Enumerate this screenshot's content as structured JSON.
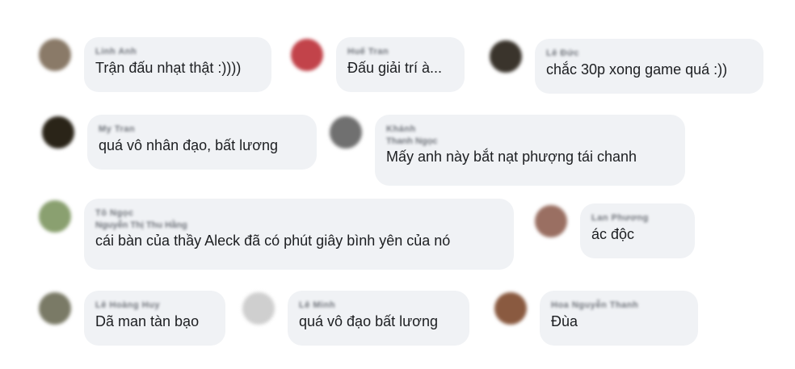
{
  "comments": [
    {
      "name": "Linh Anh",
      "meta": "",
      "text": "Trận đấu nhạt thật :))))",
      "avatar_color": "#8a7a68"
    },
    {
      "name": "Huế Tran",
      "meta": "",
      "text": "Đấu giải trí à...",
      "avatar_color": "#c2434a"
    },
    {
      "name": "Lê Đức",
      "meta": "",
      "text": "chắc 30p xong game quá :))",
      "avatar_color": "#3a342c"
    },
    {
      "name": "My Tran",
      "meta": "",
      "text": "quá vô nhân đạo, bất lương",
      "avatar_color": "#2a2418"
    },
    {
      "name": "Khánh",
      "meta": "Thanh Ngọc",
      "text": "Mấy anh này bắt nạt phượng tái chanh",
      "avatar_color": "#707070"
    },
    {
      "name": "Tô Ngọc",
      "meta": "Nguyễn Thị Thu Hằng",
      "text": "cái bàn của thầy Aleck đã có phút giây bình yên của nó",
      "avatar_color": "#8aa070"
    },
    {
      "name": "Lan Phương",
      "meta": "",
      "text": "ác độc",
      "avatar_color": "#9a6f62"
    },
    {
      "name": "Lê Hoàng Huy",
      "meta": "",
      "text": "Dã man tàn bạo",
      "avatar_color": "#7a7a66"
    },
    {
      "name": "Lê Minh",
      "meta": "",
      "text": "quá vô đạo bất lương",
      "avatar_color": "#cfcfcf"
    },
    {
      "name": "Hoa Nguyễn Thanh",
      "meta": "",
      "text": "Đùa",
      "avatar_color": "#8a5a40"
    }
  ]
}
